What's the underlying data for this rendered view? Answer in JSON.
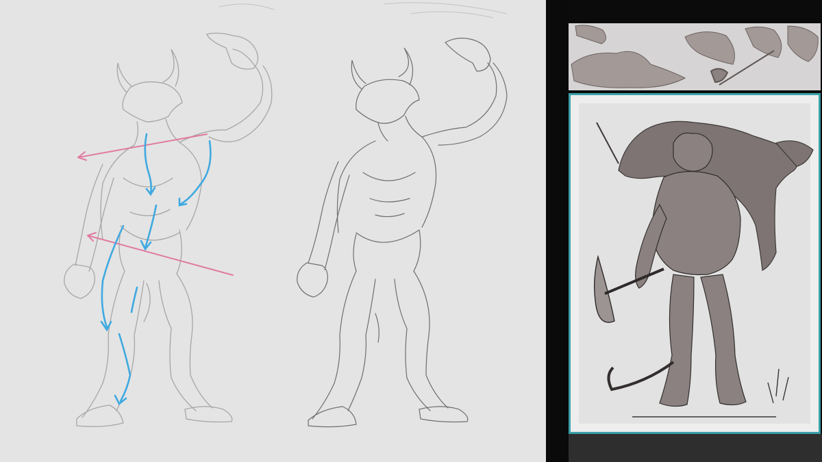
{
  "workspace": {
    "canvas_background": "#e4e4e4",
    "sketch_stroke_color": "#9a9a9a",
    "lineart_stroke_color": "#6e6e6e",
    "flow_arrow_color_blue": "#3fa9e0",
    "flow_arrow_color_pink": "#e07aa0"
  },
  "reference_panel": {
    "frame_color": "#3aa0a8",
    "signature_text": "",
    "watermark_text": ""
  }
}
